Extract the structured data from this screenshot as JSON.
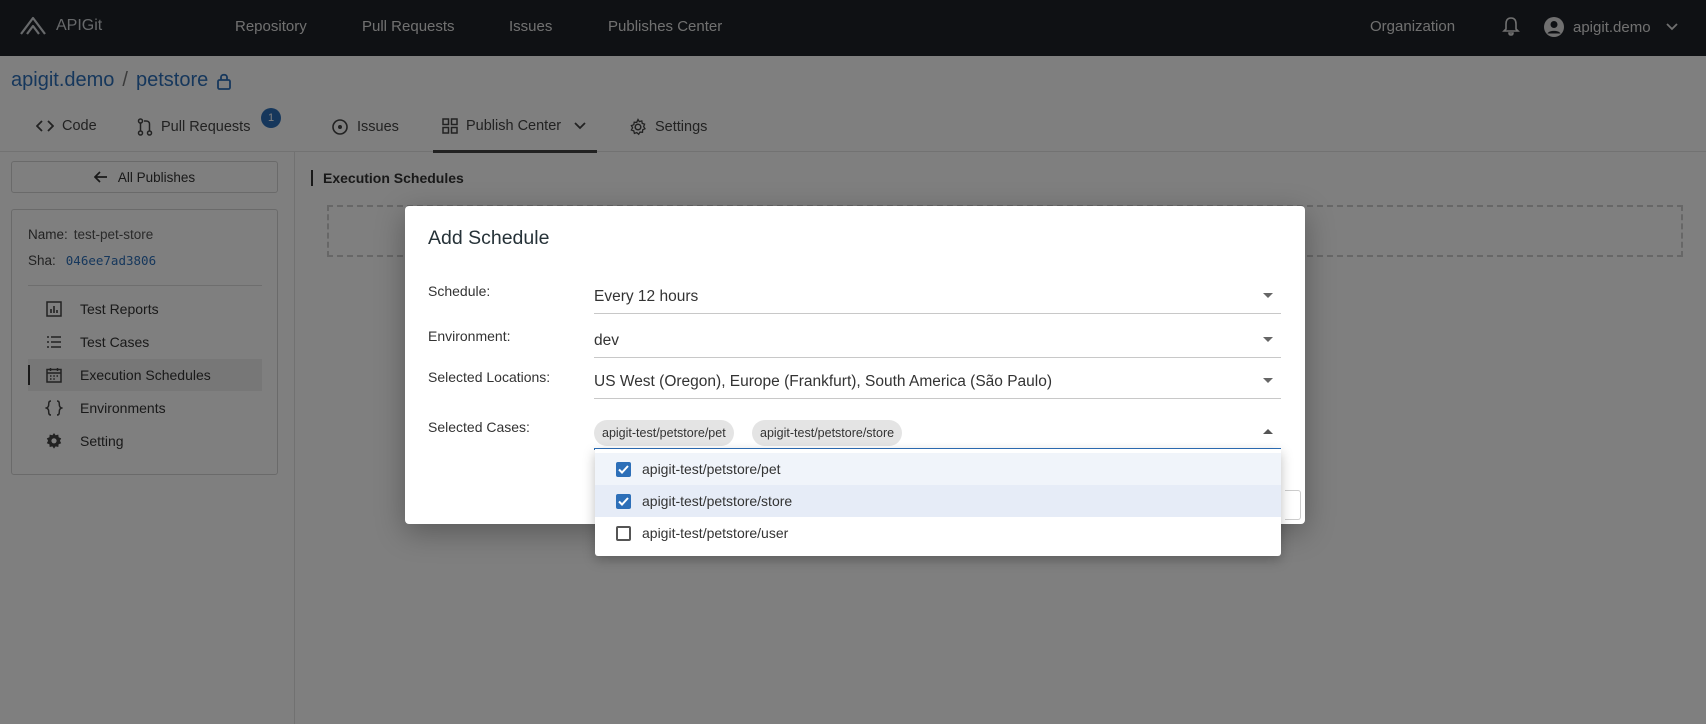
{
  "topbar": {
    "brand": "APIGit",
    "nav": [
      "Repository",
      "Pull Requests",
      "Issues",
      "Publishes Center"
    ],
    "organization": "Organization",
    "user": "apigit.demo"
  },
  "repo": {
    "owner": "apigit.demo",
    "separator": "/",
    "name": "petstore"
  },
  "tabs": [
    {
      "label": "Code"
    },
    {
      "label": "Pull Requests",
      "badge": "1"
    },
    {
      "label": "Issues"
    },
    {
      "label": "Publish Center"
    },
    {
      "label": "Settings"
    }
  ],
  "sidebar": {
    "back_label": "All Publishes",
    "name_label": "Name:",
    "name_value": "test-pet-store",
    "sha_label": "Sha:",
    "sha_value": "046ee7ad3806",
    "items": [
      {
        "label": "Test Reports"
      },
      {
        "label": "Test Cases"
      },
      {
        "label": "Execution Schedules"
      },
      {
        "label": "Environments"
      },
      {
        "label": "Setting"
      }
    ]
  },
  "main": {
    "section_title": "Execution Schedules"
  },
  "modal": {
    "title": "Add Schedule",
    "schedule_label": "Schedule:",
    "schedule_value": "Every 12 hours",
    "environment_label": "Environment:",
    "environment_value": "dev",
    "locations_label": "Selected Locations:",
    "locations_value": "US West (Oregon), Europe (Frankfurt), South America (São Paulo)",
    "cases_label": "Selected Cases:",
    "chips": [
      "apigit-test/petstore/pet",
      "apigit-test/petstore/store"
    ],
    "options": [
      {
        "label": "apigit-test/petstore/pet",
        "checked": true
      },
      {
        "label": "apigit-test/petstore/store",
        "checked": true
      },
      {
        "label": "apigit-test/petstore/user",
        "checked": false
      }
    ]
  },
  "colors": {
    "accent": "#2d6fb8",
    "topbar": "#1f2328"
  }
}
